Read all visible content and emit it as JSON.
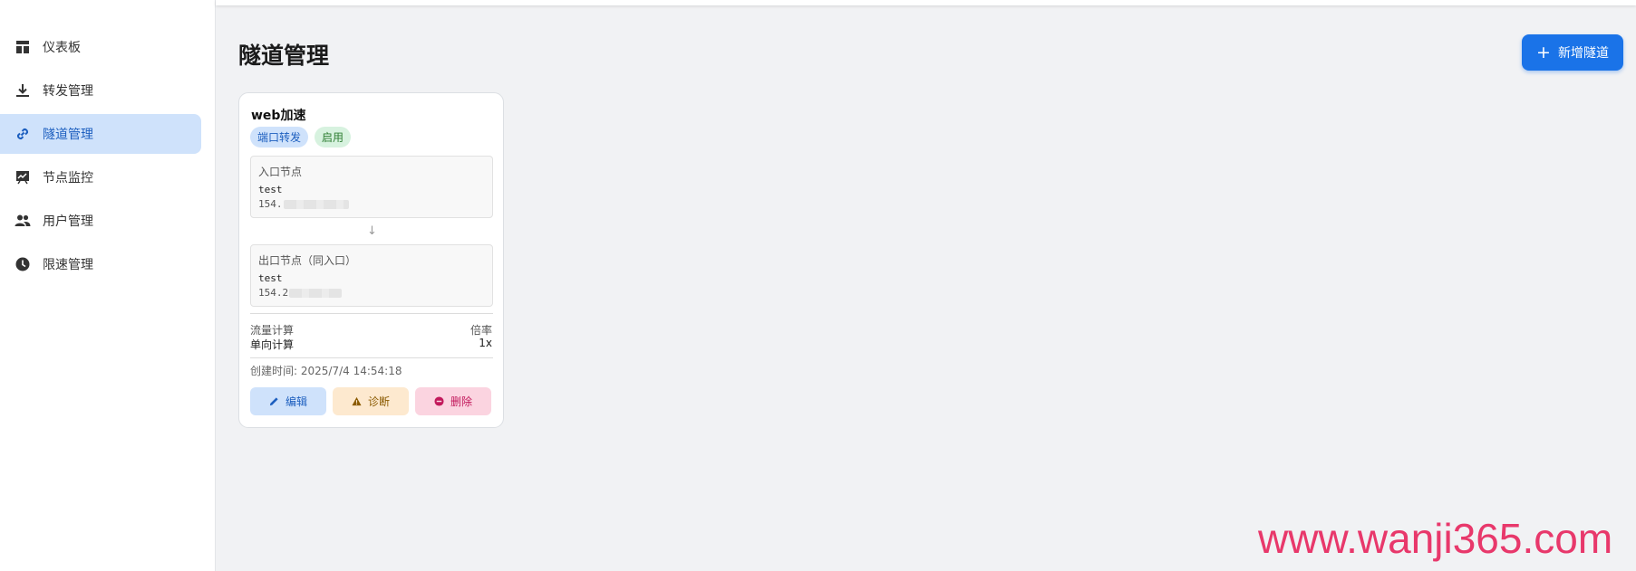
{
  "sidebar": {
    "items": [
      {
        "label": "仪表板",
        "icon": "dashboard-icon"
      },
      {
        "label": "转发管理",
        "icon": "download-icon"
      },
      {
        "label": "隧道管理",
        "icon": "link-icon",
        "active": true
      },
      {
        "label": "节点监控",
        "icon": "monitor-icon"
      },
      {
        "label": "用户管理",
        "icon": "users-icon"
      },
      {
        "label": "限速管理",
        "icon": "clock-icon"
      }
    ]
  },
  "main": {
    "title": "隧道管理",
    "add_button": "新增隧道"
  },
  "tunnel_card": {
    "name": "web加速",
    "type_badge": "端口转发",
    "status_badge": "启用",
    "entry": {
      "label": "入口节点",
      "name": "test",
      "ip_prefix": "154."
    },
    "exit": {
      "label": "出口节点（同入口）",
      "name": "test",
      "ip_prefix": "154.2"
    },
    "flow_label": "流量计算",
    "flow_value": "单向计算",
    "rate_label": "倍率",
    "rate_value": "1x",
    "created": "创建时间: 2025/7/4 14:54:18",
    "buttons": {
      "edit": "编辑",
      "diagnose": "诊断",
      "delete": "删除"
    }
  },
  "watermark": "www.wanji365.com",
  "colors": {
    "primary": "#1a73e8",
    "active_bg": "#cfe2fb",
    "success_bg": "#d7f2df",
    "warning_bg": "#fde9cf",
    "danger_bg": "#fbd4e0",
    "watermark": "#e8386b"
  }
}
